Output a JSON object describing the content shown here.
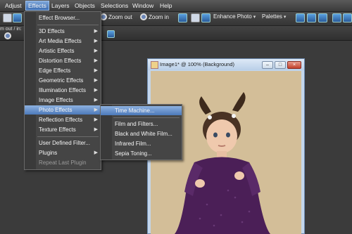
{
  "menubar": {
    "items": [
      "Adjust",
      "Effects",
      "Layers",
      "Objects",
      "Selections",
      "Window",
      "Help"
    ]
  },
  "toolbar1": {
    "zoom_out": "Zoom out",
    "zoom_in": "Zoom in",
    "enhance_photo": "Enhance Photo",
    "palettes": "Palettes"
  },
  "toolbar2": {
    "partial_label": "m out / in:"
  },
  "effects_menu": {
    "items": [
      {
        "label": "Effect Browser...",
        "submenu": false
      },
      {
        "label": "3D Effects",
        "submenu": true
      },
      {
        "label": "Art Media Effects",
        "submenu": true
      },
      {
        "label": "Artistic Effects",
        "submenu": true
      },
      {
        "label": "Distortion Effects",
        "submenu": true
      },
      {
        "label": "Edge Effects",
        "submenu": true
      },
      {
        "label": "Geometric Effects",
        "submenu": true
      },
      {
        "label": "Illumination Effects",
        "submenu": true
      },
      {
        "label": "Image Effects",
        "submenu": true
      },
      {
        "label": "Photo Effects",
        "submenu": true,
        "highlighted": true
      },
      {
        "label": "Reflection Effects",
        "submenu": true
      },
      {
        "label": "Texture Effects",
        "submenu": true
      },
      {
        "label": "User Defined Filter...",
        "submenu": false
      },
      {
        "label": "Plugins",
        "submenu": true
      },
      {
        "label": "Repeat Last Plugin",
        "submenu": false,
        "disabled": true
      }
    ]
  },
  "photo_submenu": {
    "items": [
      {
        "label": "Time Machine...",
        "highlighted": true
      },
      {
        "label": "Film and Filters..."
      },
      {
        "label": "Black and White Film..."
      },
      {
        "label": "Infrared Film..."
      },
      {
        "label": "Sepia Toning..."
      }
    ]
  },
  "image_window": {
    "title": "Image1* @ 100% (Background)"
  },
  "colors": {
    "accent": "#4c79b9",
    "menu_bg": "#454545",
    "workspace": "#3b3b3b"
  }
}
